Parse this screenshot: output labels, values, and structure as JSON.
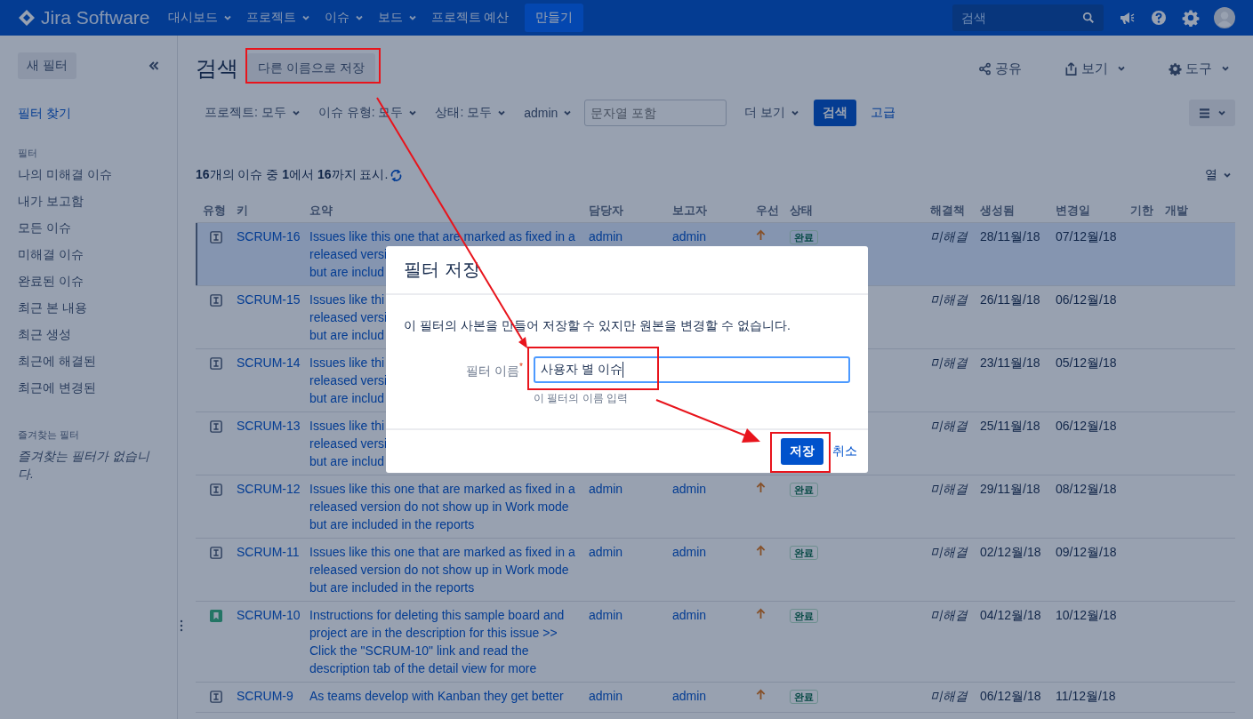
{
  "top_nav": {
    "logo": "Jira Software",
    "menus": [
      {
        "label": "대시보드",
        "dropdown": true
      },
      {
        "label": "프로젝트",
        "dropdown": true
      },
      {
        "label": "이슈",
        "dropdown": true
      },
      {
        "label": "보드",
        "dropdown": true
      },
      {
        "label": "프로젝트 예산",
        "dropdown": false
      }
    ],
    "create_button": "만들기",
    "search": {
      "placeholder": "검색"
    }
  },
  "sidebar": {
    "new_filter_button": "새 필터",
    "find_filters_link": "필터 찾기",
    "filters_heading": "필터",
    "filters": [
      "나의 미해결 이슈",
      "내가 보고함",
      "모든 이슈",
      "미해결 이슈",
      "완료된 이슈",
      "최근 본 내용",
      "최근 생성",
      "최근에 해결된",
      "최근에 변경된"
    ],
    "favorites_heading": "즐겨찾는 필터",
    "favorites_empty": "즐겨찾는 필터가 없습니다."
  },
  "header": {
    "title": "검색",
    "save_as_button": "다른 이름으로 저장",
    "actions": [
      {
        "label": "공유",
        "kind": "share",
        "dropdown": false
      },
      {
        "label": "보기",
        "kind": "export",
        "dropdown": true
      },
      {
        "label": "도구",
        "kind": "tools",
        "dropdown": true
      }
    ]
  },
  "filter_bar": {
    "filters": [
      "프로젝트: 모두",
      "이슈 유형: 모두",
      "상태: 모두",
      "admin"
    ],
    "text_search": {
      "placeholder": "문자열 포함"
    },
    "more": "더 보기",
    "search_button": "검색",
    "advanced_link": "고급"
  },
  "results": {
    "summary": "**16**개의 이슈 중 **1**에서 **16**까지 표시.",
    "columns_button": "열"
  },
  "table": {
    "columns": [
      "유형",
      "키",
      "요약",
      "담당자",
      "보고자",
      "우선",
      "상태",
      "해결책",
      "생성됨",
      "변경일",
      "기한",
      "개발"
    ],
    "rows": [
      {
        "kind": "improvement",
        "key": "SCRUM-16",
        "summary_lines": [
          "Issues like this one that are marked as fixed in a",
          "released versi",
          "but are includ"
        ],
        "assignee": "admin",
        "reporter": "admin",
        "priority_high": true,
        "status": "완료",
        "resolution": "미해결",
        "created": "28/11월/18",
        "updated": "07/12월/18",
        "selected": true
      },
      {
        "kind": "improvement",
        "key": "SCRUM-15",
        "summary_lines": [
          "Issues like thi",
          "released versi",
          "but are includ"
        ],
        "resolution": "미해결",
        "created": "26/11월/18",
        "updated": "06/12월/18",
        "selected": false
      },
      {
        "kind": "improvement",
        "key": "SCRUM-14",
        "summary_lines": [
          "Issues like thi",
          "released versi",
          "but are includ"
        ],
        "resolution": "미해결",
        "created": "23/11월/18",
        "updated": "05/12월/18",
        "selected": false
      },
      {
        "kind": "improvement",
        "key": "SCRUM-13",
        "summary_lines": [
          "Issues like thi",
          "released versi",
          "but are includ"
        ],
        "resolution": "미해결",
        "created": "25/11월/18",
        "updated": "06/12월/18",
        "selected": false
      },
      {
        "kind": "improvement",
        "key": "SCRUM-12",
        "summary_lines": [
          "Issues like this one that are marked as fixed in a",
          "released version do not show up in Work mode",
          "but are included in the reports"
        ],
        "assignee": "admin",
        "reporter": "admin",
        "priority_high": true,
        "status": "완료",
        "resolution": "미해결",
        "created": "29/11월/18",
        "updated": "08/12월/18",
        "selected": false
      },
      {
        "kind": "improvement",
        "key": "SCRUM-11",
        "summary_lines": [
          "Issues like this one that are marked as fixed in a",
          "released version do not show up in Work mode",
          "but are included in the reports"
        ],
        "assignee": "admin",
        "reporter": "admin",
        "priority_high": true,
        "status": "완료",
        "resolution": "미해결",
        "created": "02/12월/18",
        "updated": "09/12월/18",
        "selected": false
      },
      {
        "kind": "story",
        "key": "SCRUM-10",
        "summary_lines": [
          "Instructions for deleting this sample board and",
          "project are in the description for this issue >>",
          "Click the \"SCRUM-10\" link and read the",
          "description tab of the detail view for more"
        ],
        "assignee": "admin",
        "reporter": "admin",
        "priority_high": true,
        "status": "완료",
        "resolution": "미해결",
        "created": "04/12월/18",
        "updated": "10/12월/18",
        "selected": false
      },
      {
        "kind": "improvement",
        "key": "SCRUM-9",
        "summary_lines": [
          "As teams develop with Kanban they get better"
        ],
        "assignee": "admin",
        "reporter": "admin",
        "priority_high": true,
        "status": "완료",
        "resolution": "미해결",
        "created": "06/12월/18",
        "updated": "11/12월/18",
        "selected": false
      }
    ]
  },
  "dialog": {
    "title": "필터 저장",
    "message": "이 필터의 사본을 만들어 저장할 수 있지만 원본을 변경할 수 없습니다.",
    "field_label": "필터 이름",
    "required_mark": "*",
    "field_value": "사용자 별 이슈",
    "field_hint": "이 필터의 이름 입력",
    "save_button": "저장",
    "cancel_link": "취소"
  }
}
